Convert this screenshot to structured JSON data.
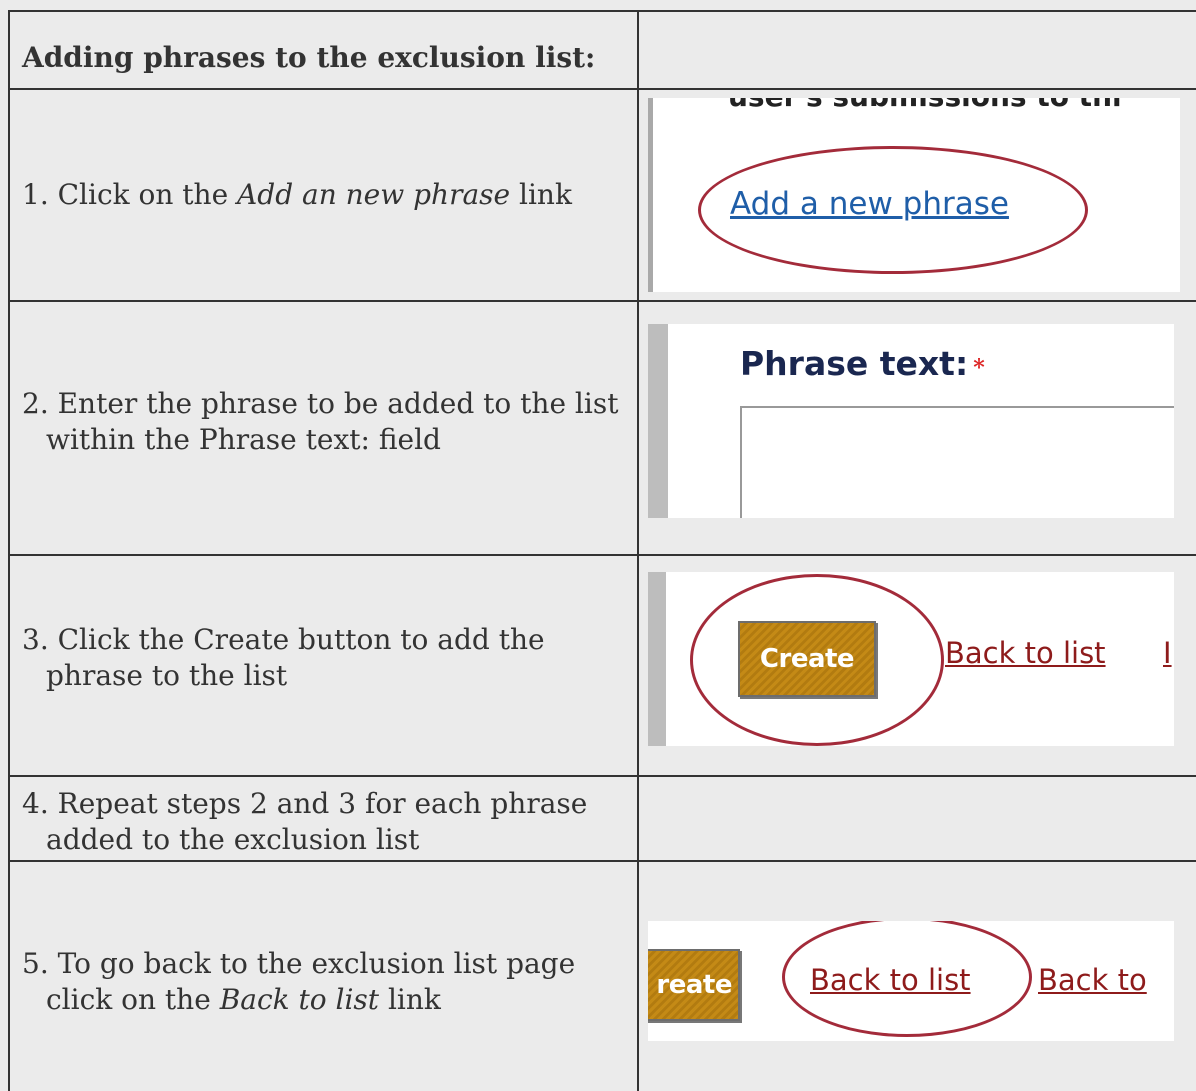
{
  "table": {
    "header": "Adding phrases to the exclusion list:",
    "steps": [
      {
        "prefix": "1. Click on the ",
        "emphasis": "Add an new phrase",
        "suffix": " link"
      },
      {
        "line1": "2. Enter the phrase to be added to the list",
        "line2": "within the Phrase text: field"
      },
      {
        "line1": "3. Click the Create button to add the",
        "line2": "phrase to the list"
      },
      {
        "line1": "4. Repeat steps 2 and 3 for each phrase",
        "line2": "added to the exclusion list"
      },
      {
        "line1": "5. To go back to the exclusion list page",
        "line2_prefix": "click on the ",
        "line2_emphasis": "Back to list",
        "line2_suffix": " link"
      }
    ]
  },
  "shots": {
    "shot1": {
      "cut_text": "user's submissions to thi",
      "link": "Add a new phrase"
    },
    "shot2": {
      "label": "Phrase text:",
      "required_mark": "*"
    },
    "shot3": {
      "button": "Create",
      "link": "Back to list",
      "trailing": "I"
    },
    "shot5": {
      "button_partial": "reate",
      "link": "Back to list",
      "link_partial": "Back to"
    }
  },
  "colors": {
    "ellipse": "#a32b3a",
    "link_blue": "#1f5ea8",
    "link_red": "#8e1b1b",
    "button": "#c48a16"
  }
}
